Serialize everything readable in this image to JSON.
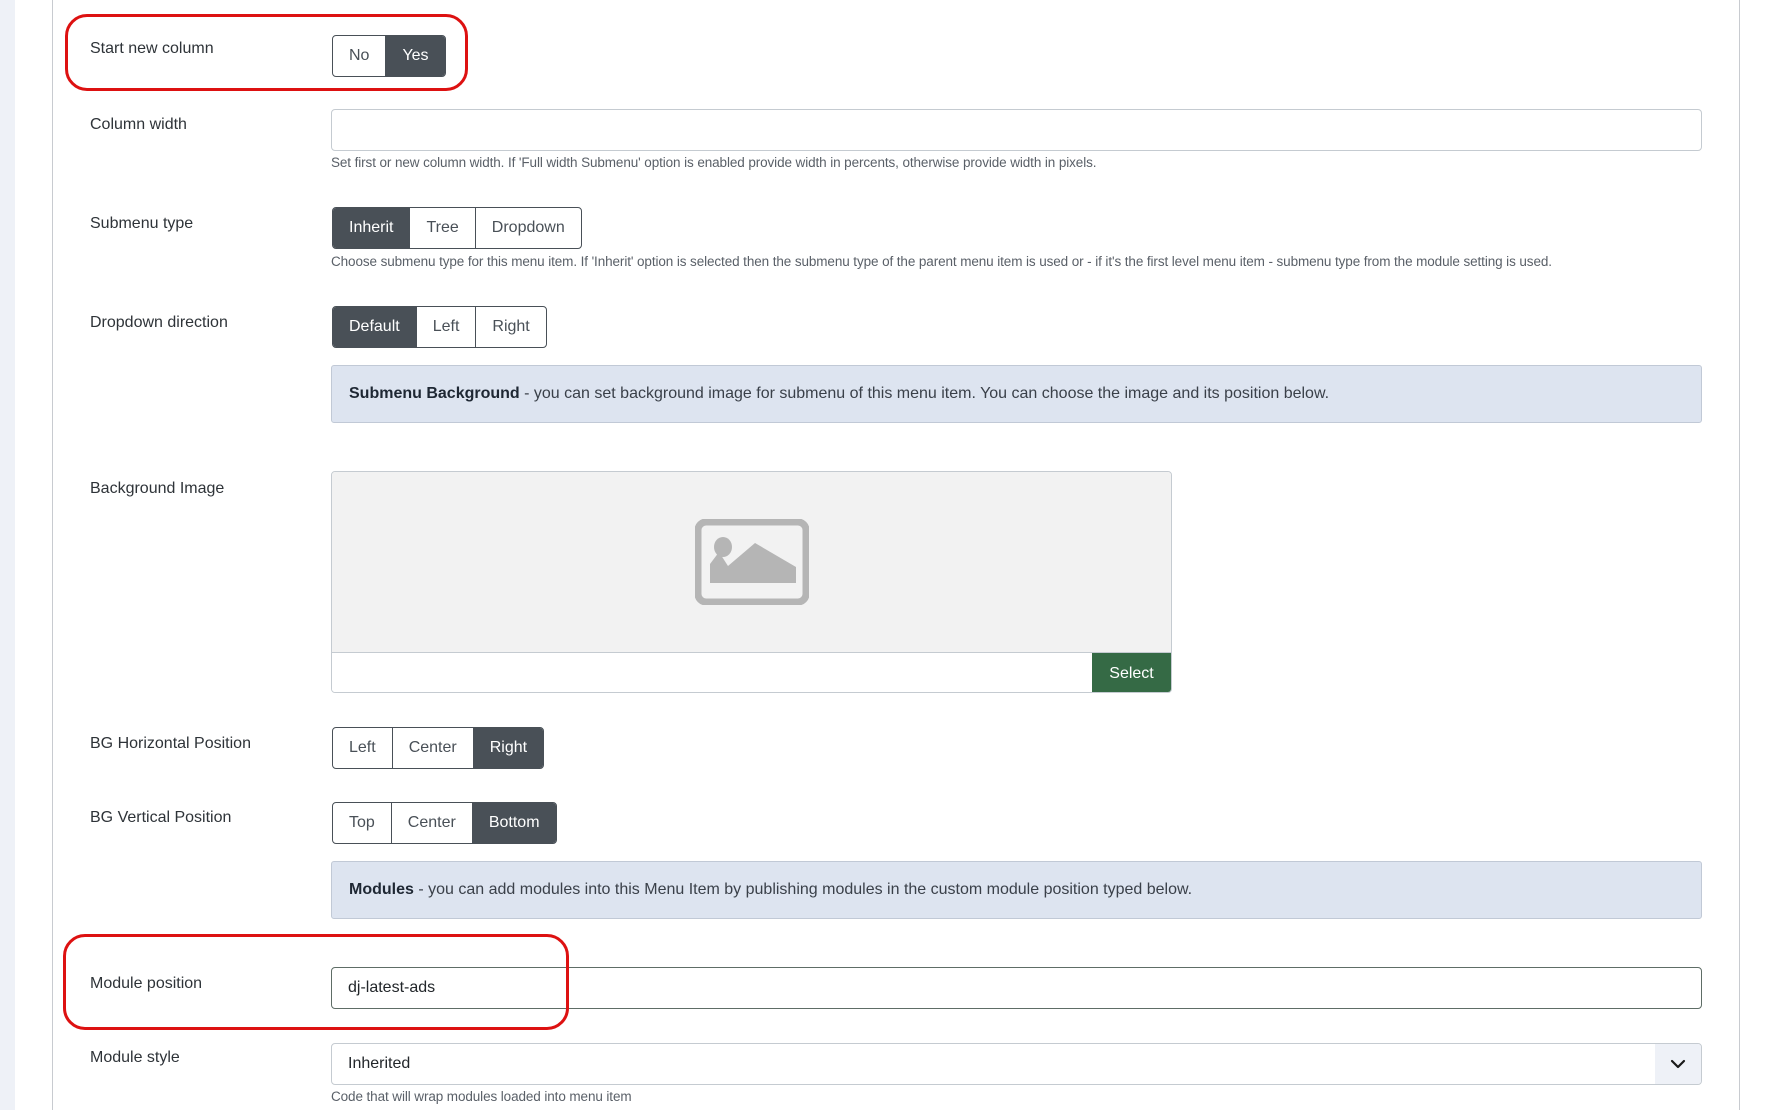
{
  "fields": {
    "start_new_column": {
      "label": "Start new column",
      "options": [
        "No",
        "Yes"
      ],
      "selected": "Yes"
    },
    "column_width": {
      "label": "Column width",
      "value": "",
      "help": "Set first or new column width. If 'Full width Submenu' option is enabled provide width in percents, otherwise provide width in pixels."
    },
    "submenu_type": {
      "label": "Submenu type",
      "options": [
        "Inherit",
        "Tree",
        "Dropdown"
      ],
      "selected": "Inherit",
      "help": "Choose submenu type for this menu item. If 'Inherit' option is selected then the submenu type of the parent menu item is used or - if it's the first level menu item - submenu type from the module setting is used."
    },
    "dropdown_direction": {
      "label": "Dropdown direction",
      "options": [
        "Default",
        "Left",
        "Right"
      ],
      "selected": "Default"
    },
    "submenu_background_note": {
      "title": "Submenu Background",
      "text": " - you can set background image for submenu of this menu item. You can choose the image and its position below."
    },
    "background_image": {
      "label": "Background Image",
      "value": "",
      "select_label": "Select",
      "placeholder_icon": "image-placeholder-icon"
    },
    "bg_horizontal_position": {
      "label": "BG Horizontal Position",
      "options": [
        "Left",
        "Center",
        "Right"
      ],
      "selected": "Right"
    },
    "bg_vertical_position": {
      "label": "BG Vertical Position",
      "options": [
        "Top",
        "Center",
        "Bottom"
      ],
      "selected": "Bottom"
    },
    "modules_note": {
      "title": "Modules",
      "text": " - you can add modules into this Menu Item by publishing modules in the custom module position typed below."
    },
    "module_position": {
      "label": "Module position",
      "value": "dj-latest-ads"
    },
    "module_style": {
      "label": "Module style",
      "value": "Inherited",
      "help": "Code that will wrap modules loaded into menu item"
    }
  },
  "colors": {
    "active_toggle": "#495057",
    "select_button": "#356a45",
    "annotation_highlight": "#dd1111",
    "info_box": "#dde4f0"
  }
}
